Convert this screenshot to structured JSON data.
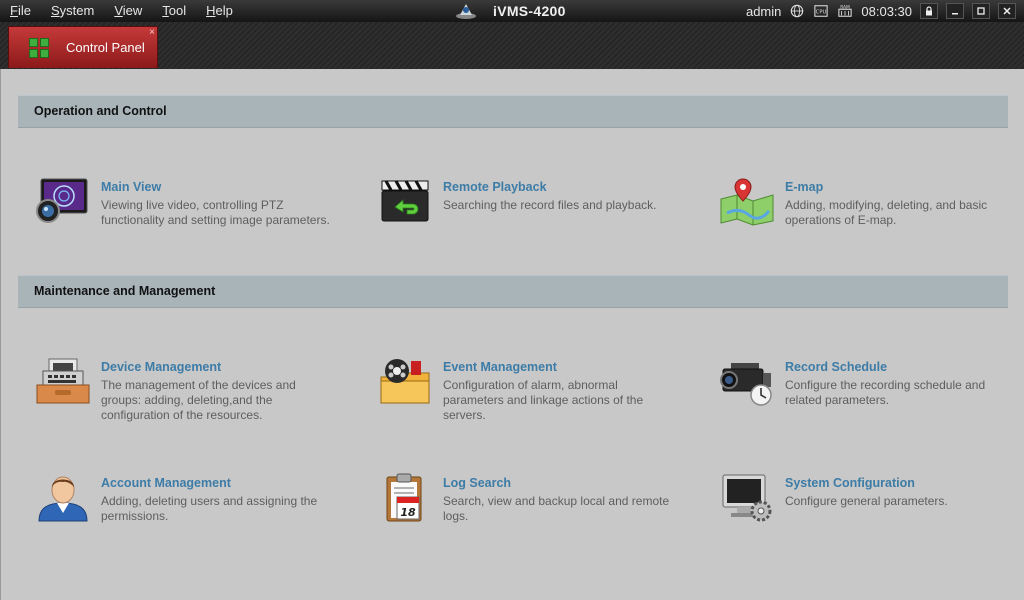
{
  "menubar": {
    "menus": [
      {
        "accel": "F",
        "rest": "ile"
      },
      {
        "accel": "S",
        "rest": "ystem"
      },
      {
        "accel": "V",
        "rest": "iew"
      },
      {
        "accel": "T",
        "rest": "ool"
      },
      {
        "accel": "H",
        "rest": "elp"
      }
    ],
    "app_title": "iVMS-4200",
    "user": "admin",
    "cpu_label": "CPU",
    "ram_label": "RAM",
    "time": "08:03:30"
  },
  "tab": {
    "label": "Control Panel",
    "close": "×"
  },
  "sections": {
    "operation": {
      "title": "Operation and Control",
      "items": [
        {
          "label": "Main View",
          "desc": "Viewing live video, controlling PTZ functionality and setting image parameters.",
          "icon": "main-view-icon"
        },
        {
          "label": "Remote Playback",
          "desc": "Searching the record files and playback.",
          "icon": "clapperboard-icon"
        },
        {
          "label": "E-map",
          "desc": "Adding, modifying, deleting, and basic operations of E-map.",
          "icon": "map-pin-icon"
        }
      ]
    },
    "maintenance": {
      "title": "Maintenance and Management",
      "items": [
        {
          "label": "Device Management",
          "desc": "The management of the devices and groups: adding, deleting,and the configuration of the resources.",
          "icon": "device-drawer-icon"
        },
        {
          "label": "Event Management",
          "desc": "Configuration of alarm, abnormal parameters and linkage actions of the servers.",
          "icon": "event-folder-icon"
        },
        {
          "label": "Record Schedule",
          "desc": "Configure the recording schedule and related parameters.",
          "icon": "camera-clock-icon"
        },
        {
          "label": "Account Management",
          "desc": "Adding, deleting users and assigning the permissions.",
          "icon": "user-account-icon"
        },
        {
          "label": "Log Search",
          "desc": "Search, view and backup local and remote logs.",
          "icon": "calendar-clipboard-icon",
          "calendar_day": "18"
        },
        {
          "label": "System Configuration",
          "desc": "Configure general parameters.",
          "icon": "monitor-gear-icon"
        }
      ]
    }
  },
  "colors": {
    "tab_active": "#a82a2a",
    "item_label": "#3d7ca7",
    "section_bar": "#a9b4b9"
  }
}
